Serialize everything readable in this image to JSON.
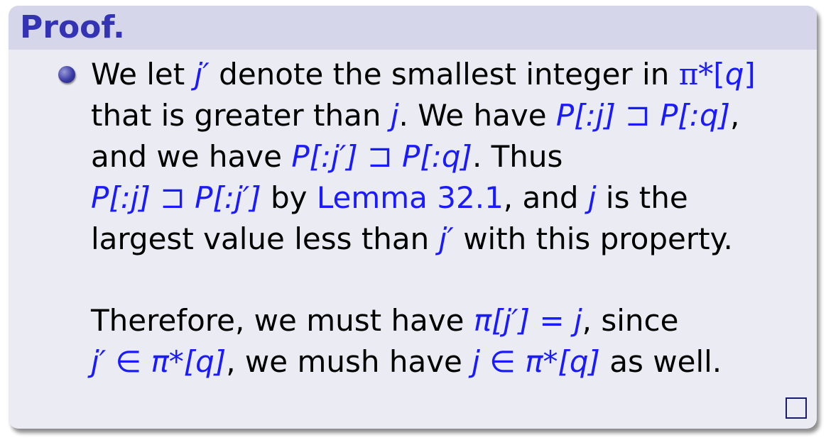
{
  "block": {
    "title": "Proof."
  },
  "paragraph1": {
    "line1": {
      "a": "We let ",
      "jp": "j′",
      "b": " denote the smallest integer in ",
      "pistar": "π*",
      "c": "[",
      "q": "q",
      "d": "]"
    },
    "line2": {
      "a": "that is greater than ",
      "j": "j",
      "b": ". We have ",
      "expr1": "P[:j]",
      "rel": " ⊐ ",
      "expr2": "P[:q]",
      "c": ","
    },
    "line3": {
      "a": "and we have ",
      "expr1": "P[:j′]",
      "rel": " ⊐ ",
      "expr2": "P[:q]",
      "b": ". Thus"
    },
    "line4": {
      "expr1": "P[:j]",
      "rel": " ⊐ ",
      "expr2": "P[:j′]",
      "a": " by ",
      "link": "Lemma 32.1",
      "b": ", and ",
      "j": "j",
      "c": " is the"
    },
    "line5": {
      "a": "largest value less than ",
      "jp": "j′",
      "b": " with this property."
    }
  },
  "paragraph2": {
    "line1": {
      "a": "Therefore, we must have ",
      "expr": "π[j′] = j",
      "b": ", since"
    },
    "line2": {
      "expr1": "j′ ∈ π*[q]",
      "a": ", we mush have ",
      "expr2": "j ∈ π*[q]",
      "b": " as well."
    }
  },
  "colors": {
    "title": "#3333b3",
    "title_bg": "#d5d6ea",
    "body_bg": "#ebebf3",
    "math": "#1a1aff"
  },
  "icons": {
    "bullet": "ball-bullet",
    "qed": "qed-square"
  }
}
